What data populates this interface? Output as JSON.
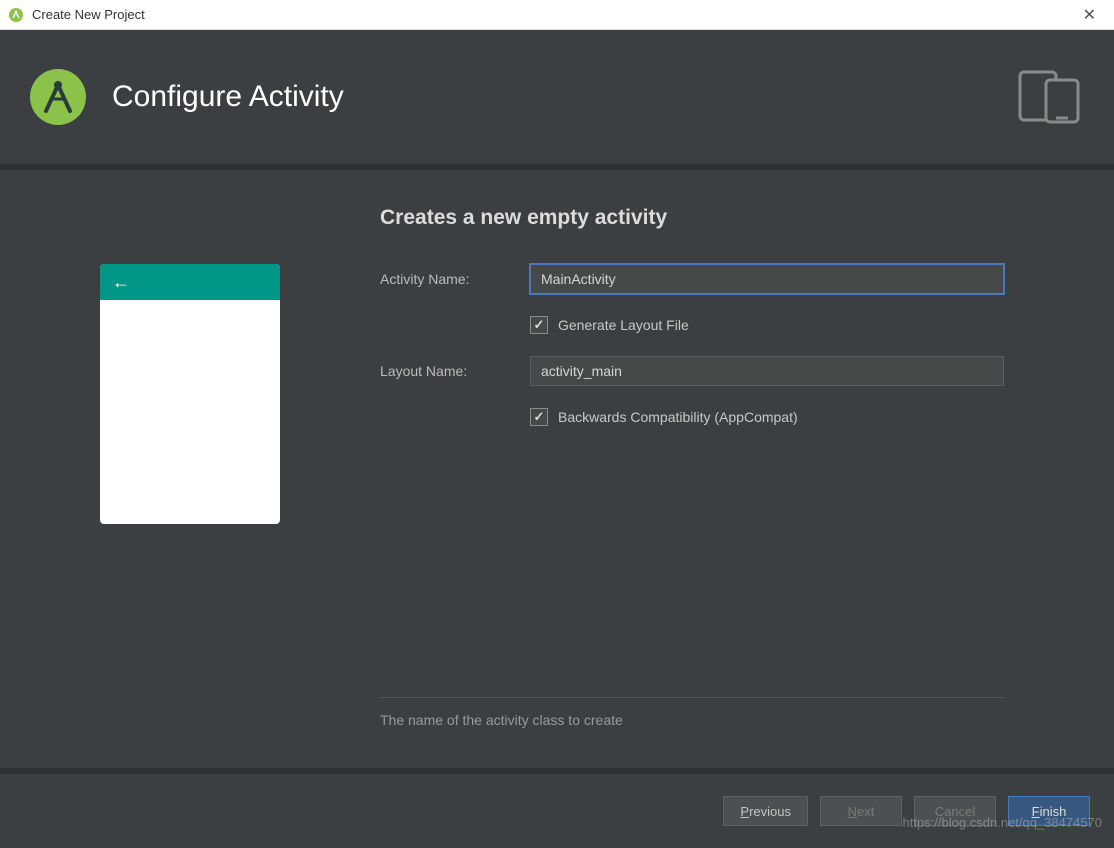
{
  "window": {
    "title": "Create New Project"
  },
  "header": {
    "title": "Configure Activity"
  },
  "form": {
    "subtitle": "Creates a new empty activity",
    "activity_name_label": "Activity Name:",
    "activity_name_value": "MainActivity",
    "generate_layout_label": "Generate Layout File",
    "generate_layout_checked": true,
    "layout_name_label": "Layout Name:",
    "layout_name_value": "activity_main",
    "appcompat_label": "Backwards Compatibility (AppCompat)",
    "appcompat_checked": true,
    "help_text": "The name of the activity class to create"
  },
  "footer": {
    "previous": "Previous",
    "next": "Next",
    "cancel": "Cancel",
    "finish": "Finish"
  },
  "watermark": "https://blog.csdn.net/qq_38474570"
}
